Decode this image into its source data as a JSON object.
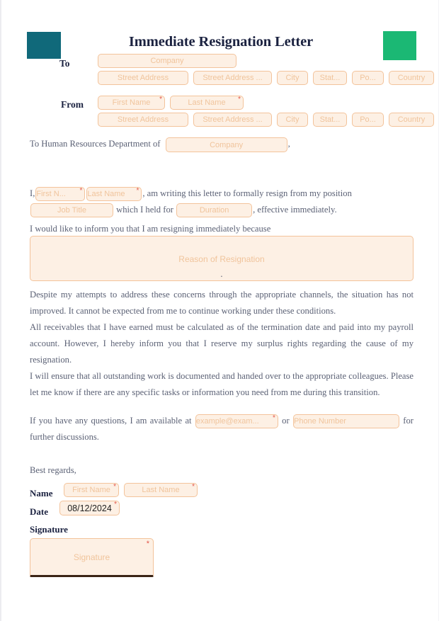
{
  "document": {
    "title": "Immediate Resignation Letter",
    "accent_teal": "#10697a",
    "accent_green": "#1bb874",
    "field_bg": "#fdf0e4",
    "field_border": "#f3c39b",
    "placeholder_color": "#f0c49c",
    "required_mark": "*"
  },
  "to_block": {
    "label": "To",
    "company_placeholder": "Company",
    "street1_placeholder": "Street Address",
    "street2_placeholder": "Street Address ...",
    "city_placeholder": "City",
    "state_placeholder": "Stat...",
    "postal_placeholder": "Po...",
    "country_placeholder": "Country"
  },
  "from_block": {
    "label": "From",
    "first_name_placeholder": "First Name",
    "last_name_placeholder": "Last Name",
    "street1_placeholder": "Street Address",
    "street2_placeholder": "Street Address ...",
    "city_placeholder": "City",
    "state_placeholder": "Stat...",
    "postal_placeholder": "Po...",
    "country_placeholder": "Country"
  },
  "letter": {
    "salutation_prefix": "To Human Resources Department of",
    "salutation_company_placeholder": "Company",
    "salutation_suffix": ",",
    "intro_i": "I,",
    "intro_first_name_placeholder": "First N...",
    "intro_last_name_placeholder": "Last Name",
    "intro_middle": ", am writing this letter to formally resign from my position",
    "job_title_placeholder": "Job Title",
    "held_for": "which I held for",
    "duration_placeholder": "Duration",
    "effective": ", effective immediately.",
    "reason_lead": "I would like to inform you that I am resigning immediately because",
    "reason_placeholder": "Reason of Resignation",
    "reason_period": ".",
    "paragraph_1": "Despite my attempts to address these concerns through the appropriate channels, the situation has not improved. It cannot be expected from me to continue working under these conditions.",
    "paragraph_2": "All receivables that I have earned must be calculated as of the termination date and paid into my payroll account. However, I hereby inform you that I reserve my surplus rights regarding the cause of my resignation.",
    "paragraph_3": "I will ensure that all outstanding work is documented and handed over to the appropriate colleagues. Please let me know if there are any specific tasks or information you need from me during this transition.",
    "contact_lead": "If you have any questions, I am available at",
    "email_placeholder": "example@exam...",
    "contact_or": "or",
    "phone_placeholder": "Phone Number",
    "contact_tail": "for further discussions."
  },
  "closing": {
    "regards": "Best regards,",
    "name_label": "Name",
    "name_first_placeholder": "First Name",
    "name_last_placeholder": "Last Name",
    "date_label": "Date",
    "date_value": "08/12/2024",
    "signature_label": "Signature",
    "signature_placeholder": "Signature"
  }
}
